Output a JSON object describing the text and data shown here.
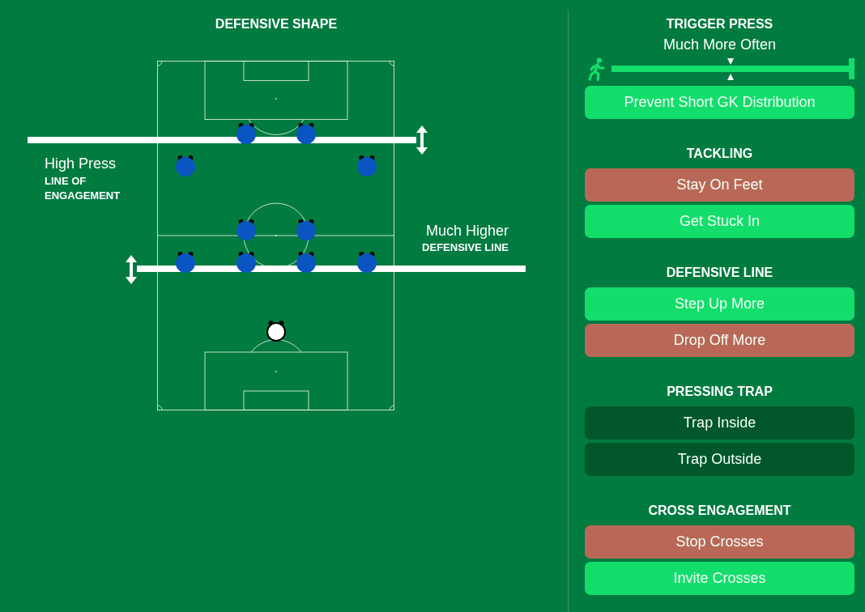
{
  "shape": {
    "title": "DEFENSIVE SHAPE",
    "lines": [
      {
        "kind": "engagement",
        "value": "High Press",
        "label": "LINE OF ENGAGEMENT"
      },
      {
        "kind": "defensive",
        "value": "Much Higher",
        "label": "DEFENSIVE LINE"
      }
    ]
  },
  "sections": [
    {
      "title": "TRIGGER PRESS",
      "slider": {
        "reading": "Much More Often",
        "level": 1
      },
      "options": [
        {
          "label": "Prevent Short GK Distribution",
          "selected": true,
          "disabled": false
        }
      ]
    },
    {
      "title": "TACKLING",
      "options": [
        {
          "label": "Stay On Feet",
          "selected": false,
          "disabled": true
        },
        {
          "label": "Get Stuck In",
          "selected": true,
          "disabled": false
        }
      ]
    },
    {
      "title": "DEFENSIVE LINE",
      "options": [
        {
          "label": "Step Up More",
          "selected": true,
          "disabled": false
        },
        {
          "label": "Drop Off More",
          "selected": false,
          "disabled": true
        }
      ]
    },
    {
      "title": "PRESSING TRAP",
      "options": [
        {
          "label": "Trap Inside",
          "selected": false,
          "disabled": false
        },
        {
          "label": "Trap Outside",
          "selected": false,
          "disabled": false
        }
      ]
    },
    {
      "title": "CROSS ENGAGEMENT",
      "options": [
        {
          "label": "Stop Crosses",
          "selected": false,
          "disabled": true
        },
        {
          "label": "Invite Crosses",
          "selected": true,
          "disabled": false
        }
      ]
    }
  ]
}
